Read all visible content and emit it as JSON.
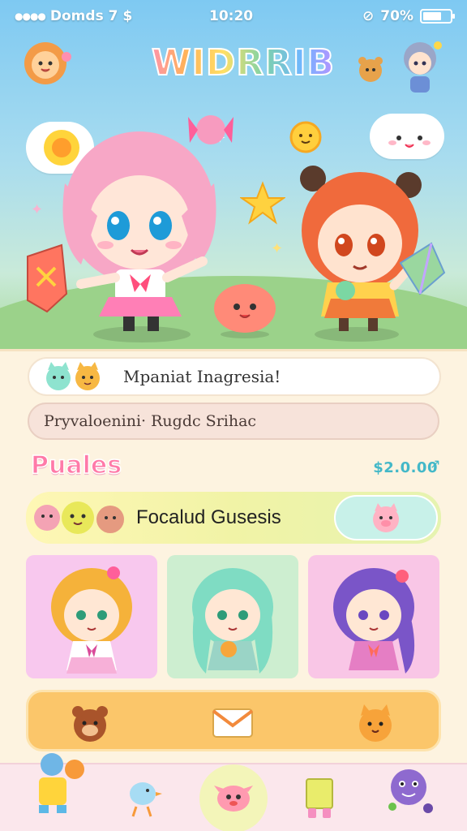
{
  "status": {
    "carrier": "Domds 7",
    "time": "10:20",
    "battery_text": "70%",
    "battery_level": 0.7
  },
  "header": {
    "logo_text": "WIDRRIB"
  },
  "banner": {
    "text": "Mpaniat Inagresia!"
  },
  "search": {
    "value": "Pryvaloenini· Rugdc Srihac"
  },
  "section": {
    "title": "Puales",
    "price": "$2.0.00"
  },
  "featured": {
    "label": "Focalud Gusesis"
  },
  "cards": [
    {
      "color": "#f8c8ee",
      "hair": "#f5b23a"
    },
    {
      "color": "#cdeed0",
      "hair": "#7fdcc3"
    },
    {
      "color": "#f9c6e6",
      "hair": "#7a55c8"
    }
  ],
  "colors": {
    "accent_pink": "#ff7aa8",
    "accent_teal": "#43b8c8",
    "action_bar": "#fbc66a"
  },
  "icons": {
    "action_left": "bear-face-icon",
    "action_center": "mail-envelope-icon",
    "action_right": "cat-face-icon",
    "tab_home": "character-home-icon",
    "tab_bird": "bird-icon",
    "tab_pet": "pet-creature-icon",
    "tab_gift": "gift-box-icon",
    "tab_monster": "monster-icon"
  }
}
